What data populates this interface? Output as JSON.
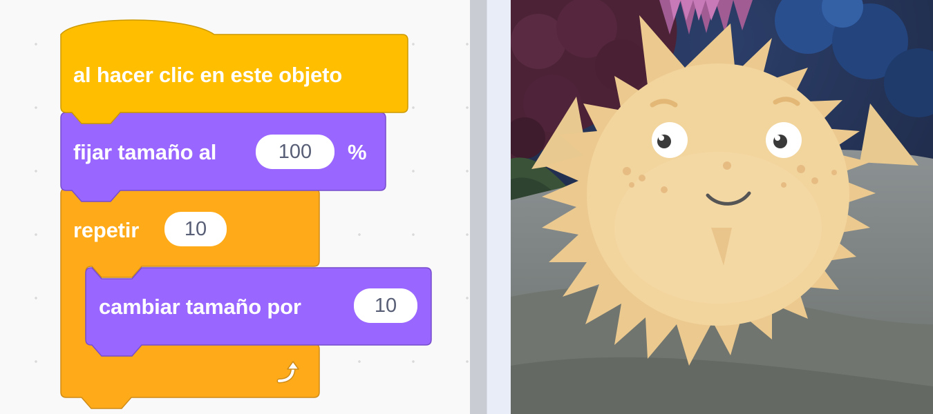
{
  "code_area": {
    "hat_block": {
      "label": "al hacer clic en este objeto",
      "color": "#ffbf00"
    },
    "set_size_block": {
      "label": "fijar tamaño al",
      "value": "100",
      "unit": "%",
      "color": "#9966ff"
    },
    "repeat_block": {
      "label": "repetir",
      "count": "10",
      "color": "#ffab19",
      "loop_icon": "loop-arrow-icon"
    },
    "change_size_block": {
      "label": "cambiar tamaño por",
      "value": "10",
      "color": "#9966ff"
    }
  },
  "stage": {
    "sprite": "pufferfish",
    "backdrop": "underwater"
  }
}
